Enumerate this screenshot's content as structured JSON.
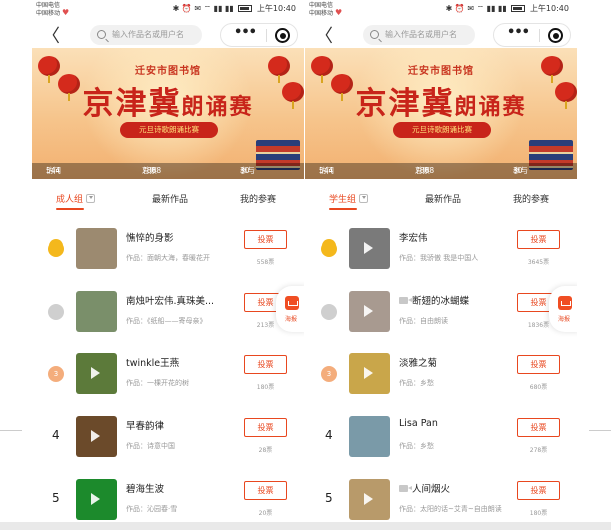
{
  "status_bar": {
    "carrier_top": "中国电信",
    "carrier_bottom": "中国移动",
    "icons": "✱ ⏰ ✉ ⌔ ▮▮ ▮▮",
    "time": "上午10:40"
  },
  "nav": {
    "back": "〈",
    "search_placeholder": "输入作品名或用户名",
    "more": "•••"
  },
  "banner": {
    "library": "迁安市图书馆",
    "title_big": "京津冀",
    "title_small": "朗诵赛",
    "subtitle": "元旦诗歌朗诵比赛",
    "stats": {
      "visits_label": "访问量：",
      "visits": "544",
      "votes_label": "总票数：",
      "votes": "7868",
      "participants_label": "参与者：",
      "participants": "30"
    }
  },
  "left": {
    "tabs": [
      {
        "label": "成人组"
      },
      {
        "label": "最新作品"
      },
      {
        "label": "我的参赛"
      }
    ],
    "items": [
      {
        "rank": "",
        "medal": "gold",
        "title": "憔悴的身影",
        "work": "作品：面朝大海，春暖花开",
        "votes": "558票",
        "video": false
      },
      {
        "rank": "",
        "medal": "silver",
        "title": "南烛叶宏伟.真珠美...",
        "work": "作品：《纸船——寄母亲》",
        "votes": "213票",
        "video": false
      },
      {
        "rank": "3",
        "medal": "bronze",
        "title": "twinkle王燕",
        "work": "作品：一棵开花的树",
        "votes": "180票",
        "video": false
      },
      {
        "rank": "4",
        "medal": "",
        "title": "早春韵律",
        "work": "作品：诗意中国",
        "votes": "28票",
        "video": false
      },
      {
        "rank": "5",
        "medal": "",
        "title": "碧海生波",
        "work": "作品：沁园春·雪",
        "votes": "20票",
        "video": false
      }
    ]
  },
  "right": {
    "tabs": [
      {
        "label": "学生组"
      },
      {
        "label": "最新作品"
      },
      {
        "label": "我的参赛"
      }
    ],
    "items": [
      {
        "rank": "",
        "medal": "gold",
        "title": "李宏伟",
        "work": "作品：我骄傲 我是中国人",
        "votes": "3645票",
        "video": false
      },
      {
        "rank": "",
        "medal": "silver",
        "title": "断翅的冰蝴蝶",
        "work": "作品：自由朗读",
        "votes": "1836票",
        "video": true
      },
      {
        "rank": "3",
        "medal": "bronze",
        "title": "淡雅之菊",
        "work": "作品：乡愁",
        "votes": "680票",
        "video": false
      },
      {
        "rank": "4",
        "medal": "",
        "title": "Lisa Pan",
        "work": "作品：乡愁",
        "votes": "278票",
        "video": false
      },
      {
        "rank": "5",
        "medal": "",
        "title": "人间烟火",
        "work": "作品：太阳的话~艾青~自由朗读",
        "votes": "180票",
        "video": true
      }
    ]
  },
  "vote_label": "投票",
  "poster_label": "海报",
  "colors": {
    "accent": "#e8471f",
    "banner_red": "#c8241a",
    "gold": "#f4b81c",
    "silver": "#cfcfcf",
    "bronze": "#f4ad7c"
  }
}
